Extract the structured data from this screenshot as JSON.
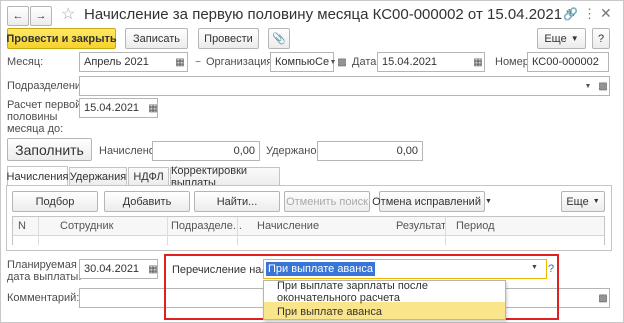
{
  "window": {
    "title": "Начисление за первую половину месяца КС00-000002 от 15.04.2021 *"
  },
  "toolbar": {
    "post_close": "Провести и закрыть",
    "save": "Записать",
    "post": "Провести",
    "more": "Еще",
    "help": "?"
  },
  "header": {
    "month_label": "Месяц:",
    "month_value": "Апрель 2021",
    "org_label": "Организация:",
    "org_value": "КомпьюСе",
    "date_label": "Дата:",
    "date_value": "15.04.2021",
    "number_label": "Номер:",
    "number_value": "КС00-000002",
    "dept_label": "Подразделение:",
    "dept_value": "",
    "calc_label_1": "Расчет первой",
    "calc_label_2": "половины",
    "calc_label_3": "месяца до:",
    "calc_value": "15.04.2021"
  },
  "summary": {
    "fill_button": "Заполнить",
    "accrued_label": "Начислено:",
    "accrued_value": "0,00",
    "withheld_label": "Удержано:",
    "withheld_value": "0,00"
  },
  "tabs": [
    {
      "label": "Начисления"
    },
    {
      "label": "Удержания"
    },
    {
      "label": "НДФЛ"
    },
    {
      "label": "Корректировки выплаты"
    }
  ],
  "table_toolbar": {
    "pick": "Подбор",
    "add": "Добавить",
    "find": "Найти...",
    "cancel_search": "Отменить поиск",
    "cancel_fix": "Отмена исправлений",
    "more": "Еще"
  },
  "table": {
    "columns": [
      "N",
      "Сотрудник",
      "Подразделе...",
      "Начисление",
      "Результат",
      "Период"
    ]
  },
  "footer": {
    "pay_date_label_1": "Планируемая",
    "pay_date_label_2": "дата выплаты:",
    "pay_date_value": "30.04.2021",
    "tax_label": "Перечисление налога:",
    "tax_value": "При выплате аванса",
    "tax_help": "?",
    "comment_label": "Комментарий:",
    "comment_value": ""
  },
  "dropdown": {
    "options": [
      "При выплате зарплаты после окончательного расчета",
      "При выплате аванса"
    ]
  },
  "colors": {
    "primary_button": "#f5d22b",
    "highlight_box": "#e02020",
    "selected_text_bg": "#3875d7",
    "dropdown_selected": "#fbe58a"
  }
}
